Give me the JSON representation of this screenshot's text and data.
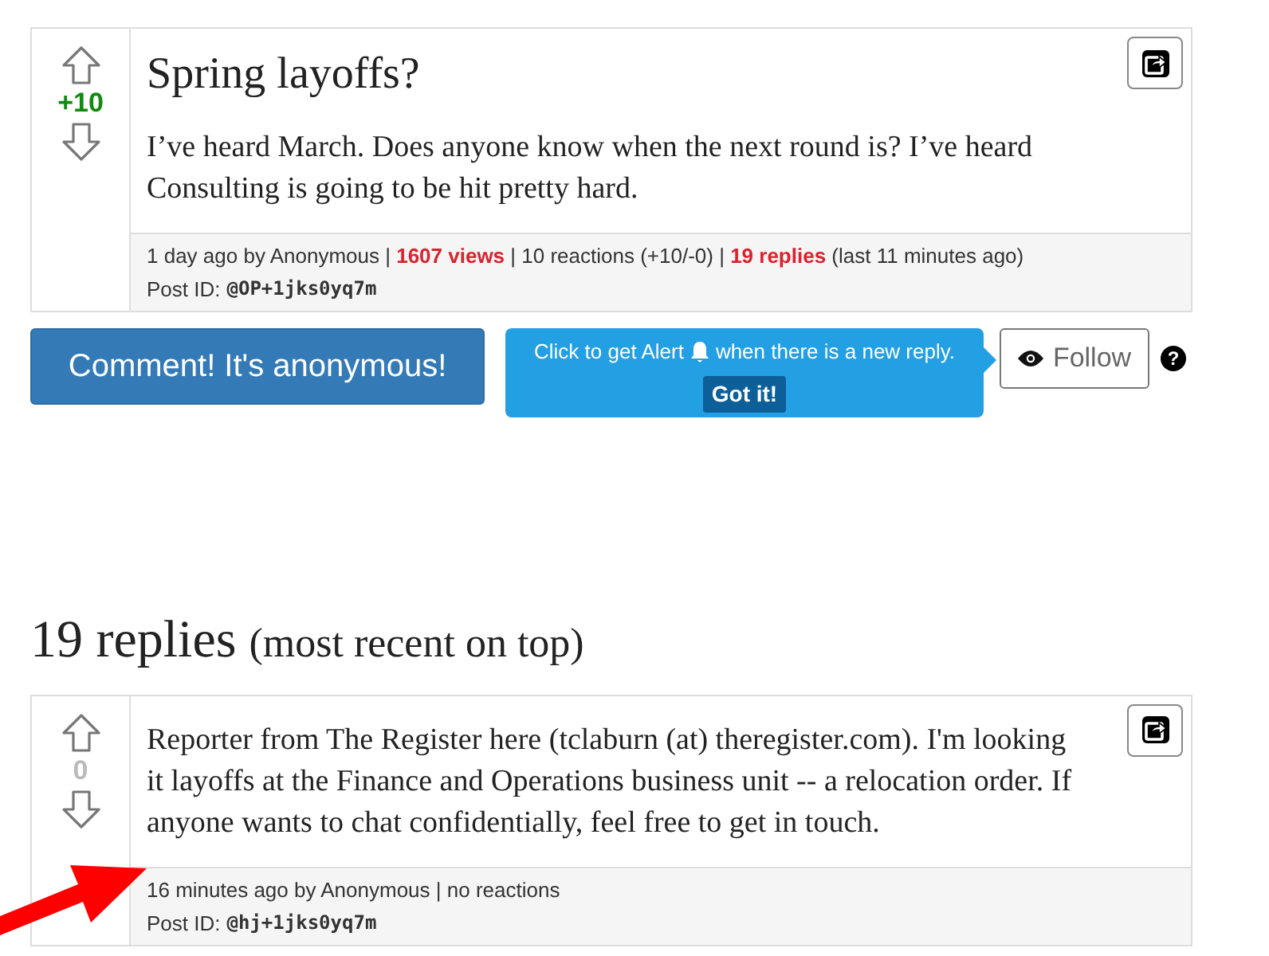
{
  "original_post": {
    "score": "+10",
    "color": "#118a11",
    "title": "Spring layoffs?",
    "body": "I’ve heard March. Does anyone know when the next round is? I’ve heard Consulting is going to be hit pretty hard.",
    "meta": "1 day ago by Anonymous | **1607 views** | 10 reactions (+10/-0) | **19 replies** (last 11 minutes ago)",
    "post_id_label": "Post ID:",
    "post_id": "@OP+1jks0yq7m"
  },
  "comment_button": "Comment! It's anonymous!",
  "alert_tip": {
    "text_before": "Click to get Alert",
    "text_after": "when there is a new reply.",
    "button": "Got it!"
  },
  "follow_button": "Follow",
  "help_icon": "?",
  "replies_section": {
    "heading": "19 replies",
    "note": "(most recent on top)",
    "replies": [
      {
        "score": "0",
        "color": "#bbbbbb",
        "body": "Reporter from The Register here (tclaburn (at) theregister.com). I'm looking it layoffs at the Finance and Operations business unit -- a relocation order. If anyone wants to chat confidentially, feel free to get in touch.",
        "meta": "16 minutes ago by Anonymous | no reactions",
        "post_id_label": "Post ID:",
        "post_id": "@hj+1jks0yq7m"
      }
    ]
  }
}
